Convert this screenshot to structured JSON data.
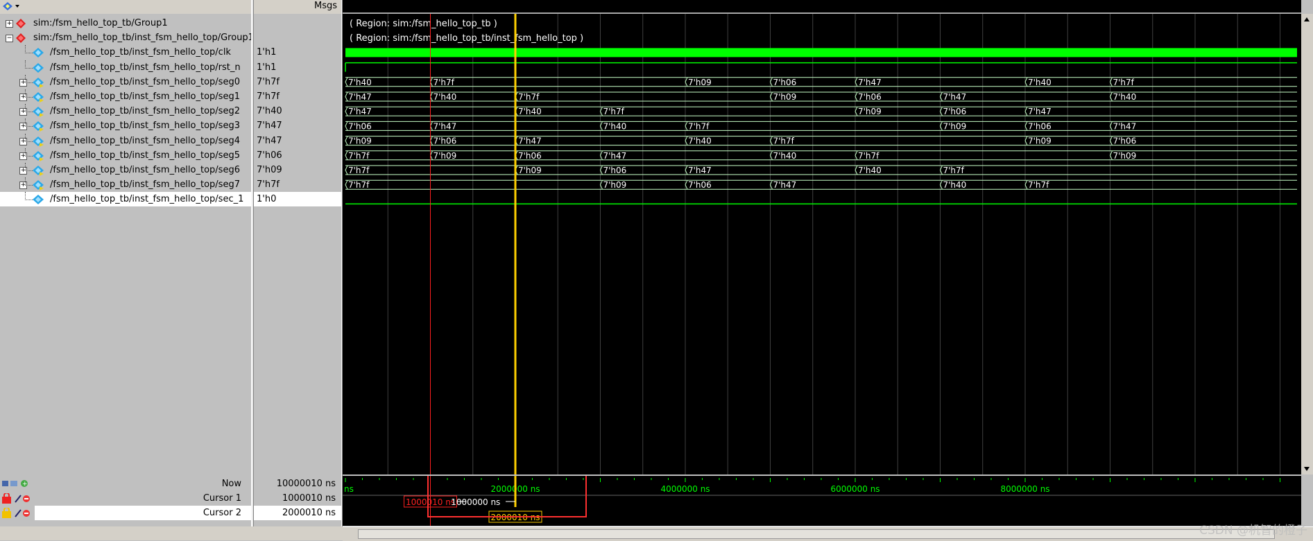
{
  "header": {
    "msgs_label": "Msgs"
  },
  "signals": [
    {
      "name": "sim:/fsm_hello_top_tb/Group1",
      "value": "",
      "kind": "group",
      "indent": 0
    },
    {
      "name": "sim:/fsm_hello_top_tb/inst_fsm_hello_top/Group1",
      "value": "",
      "kind": "group-open",
      "indent": 0
    },
    {
      "name": "/fsm_hello_top_tb/inst_fsm_hello_top/clk",
      "value": "1'h1",
      "kind": "bit",
      "indent": 1
    },
    {
      "name": "/fsm_hello_top_tb/inst_fsm_hello_top/rst_n",
      "value": "1'h1",
      "kind": "bit",
      "indent": 1
    },
    {
      "name": "/fsm_hello_top_tb/inst_fsm_hello_top/seg0",
      "value": "7'h7f",
      "kind": "bus",
      "indent": 1
    },
    {
      "name": "/fsm_hello_top_tb/inst_fsm_hello_top/seg1",
      "value": "7'h7f",
      "kind": "bus",
      "indent": 1
    },
    {
      "name": "/fsm_hello_top_tb/inst_fsm_hello_top/seg2",
      "value": "7'h40",
      "kind": "bus",
      "indent": 1
    },
    {
      "name": "/fsm_hello_top_tb/inst_fsm_hello_top/seg3",
      "value": "7'h47",
      "kind": "bus",
      "indent": 1
    },
    {
      "name": "/fsm_hello_top_tb/inst_fsm_hello_top/seg4",
      "value": "7'h47",
      "kind": "bus",
      "indent": 1
    },
    {
      "name": "/fsm_hello_top_tb/inst_fsm_hello_top/seg5",
      "value": "7'h06",
      "kind": "bus",
      "indent": 1
    },
    {
      "name": "/fsm_hello_top_tb/inst_fsm_hello_top/seg6",
      "value": "7'h09",
      "kind": "bus",
      "indent": 1
    },
    {
      "name": "/fsm_hello_top_tb/inst_fsm_hello_top/seg7",
      "value": "7'h7f",
      "kind": "bus",
      "indent": 1
    },
    {
      "name": "/fsm_hello_top_tb/inst_fsm_hello_top/sec_1",
      "value": "1'h0",
      "kind": "bit",
      "indent": 1,
      "selected": true
    }
  ],
  "regions": [
    "( Region: sim:/fsm_hello_top_tb )",
    "( Region: sim:/fsm_hello_top_tb/inst_fsm_hello_top )"
  ],
  "time_range_ns": [
    0,
    11200000
  ],
  "bus_waves": [
    [
      {
        "t": 0,
        "v": "7'h40"
      },
      {
        "t": 1000000,
        "v": "7'h7f"
      },
      {
        "t": 4000000,
        "v": "7'h09"
      },
      {
        "t": 5000000,
        "v": "7'h06"
      },
      {
        "t": 6000000,
        "v": "7'h47"
      },
      {
        "t": 8000000,
        "v": "7'h40"
      },
      {
        "t": 9000000,
        "v": "7'h7f"
      }
    ],
    [
      {
        "t": 0,
        "v": "7'h47"
      },
      {
        "t": 1000000,
        "v": "7'h40"
      },
      {
        "t": 2000000,
        "v": "7'h7f"
      },
      {
        "t": 5000000,
        "v": "7'h09"
      },
      {
        "t": 6000000,
        "v": "7'h06"
      },
      {
        "t": 7000000,
        "v": "7'h47"
      },
      {
        "t": 9000000,
        "v": "7'h40"
      }
    ],
    [
      {
        "t": 0,
        "v": "7'h47"
      },
      {
        "t": 2000000,
        "v": "7'h40"
      },
      {
        "t": 3000000,
        "v": "7'h7f"
      },
      {
        "t": 6000000,
        "v": "7'h09"
      },
      {
        "t": 7000000,
        "v": "7'h06"
      },
      {
        "t": 8000000,
        "v": "7'h47"
      }
    ],
    [
      {
        "t": 0,
        "v": "7'h06"
      },
      {
        "t": 1000000,
        "v": "7'h47"
      },
      {
        "t": 3000000,
        "v": "7'h40"
      },
      {
        "t": 4000000,
        "v": "7'h7f"
      },
      {
        "t": 7000000,
        "v": "7'h09"
      },
      {
        "t": 8000000,
        "v": "7'h06"
      },
      {
        "t": 9000000,
        "v": "7'h47"
      }
    ],
    [
      {
        "t": 0,
        "v": "7'h09"
      },
      {
        "t": 1000000,
        "v": "7'h06"
      },
      {
        "t": 2000000,
        "v": "7'h47"
      },
      {
        "t": 4000000,
        "v": "7'h40"
      },
      {
        "t": 5000000,
        "v": "7'h7f"
      },
      {
        "t": 8000000,
        "v": "7'h09"
      },
      {
        "t": 9000000,
        "v": "7'h06"
      }
    ],
    [
      {
        "t": 0,
        "v": "7'h7f"
      },
      {
        "t": 1000000,
        "v": "7'h09"
      },
      {
        "t": 2000000,
        "v": "7'h06"
      },
      {
        "t": 3000000,
        "v": "7'h47"
      },
      {
        "t": 5000000,
        "v": "7'h40"
      },
      {
        "t": 6000000,
        "v": "7'h7f"
      },
      {
        "t": 9000000,
        "v": "7'h09"
      }
    ],
    [
      {
        "t": 0,
        "v": "7'h7f"
      },
      {
        "t": 2000000,
        "v": "7'h09"
      },
      {
        "t": 3000000,
        "v": "7'h06"
      },
      {
        "t": 4000000,
        "v": "7'h47"
      },
      {
        "t": 6000000,
        "v": "7'h40"
      },
      {
        "t": 7000000,
        "v": "7'h7f"
      }
    ],
    [
      {
        "t": 0,
        "v": "7'h7f"
      },
      {
        "t": 3000000,
        "v": "7'h09"
      },
      {
        "t": 4000000,
        "v": "7'h06"
      },
      {
        "t": 5000000,
        "v": "7'h47"
      },
      {
        "t": 7000000,
        "v": "7'h40"
      },
      {
        "t": 8000000,
        "v": "7'h7f"
      }
    ]
  ],
  "axis": {
    "first_label": "ns",
    "ticks": [
      "2000000 ns",
      "4000000 ns",
      "6000000 ns",
      "8000000 ns"
    ],
    "tick_values": [
      2000000,
      4000000,
      6000000,
      8000000
    ]
  },
  "cursors_panel": {
    "now_label": "Now",
    "now_value": "10000010 ns",
    "cursor1_label": "Cursor 1",
    "cursor1_value": "1000010 ns",
    "cursor1_time": 1000010,
    "cursor2_label": "Cursor 2",
    "cursor2_value": "2000010 ns",
    "cursor2_time": 2000010,
    "delta_label": "1000000 ns",
    "cursor1_flag": "1000010 ns",
    "cursor2_flag": "2000010 ns"
  },
  "colors": {
    "wave": "#00ff00",
    "bus": "#c8ffc8",
    "cursor1": "#ff2020",
    "cursor2": "#ffd000",
    "grid": "#404040",
    "highlight": "#ff3030"
  },
  "watermark": "CSDN @机智的橙子"
}
